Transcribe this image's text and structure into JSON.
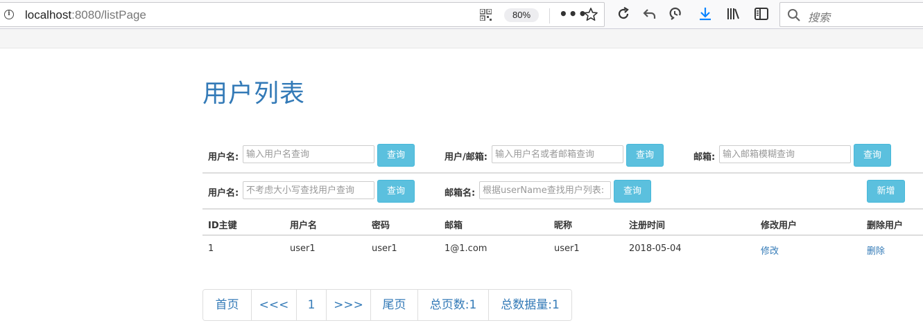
{
  "browser": {
    "url_host": "localhost",
    "url_rest": ":8080/listPage",
    "zoom": "80%",
    "search_placeholder": "搜索"
  },
  "page": {
    "title": "用户列表"
  },
  "filters": {
    "row1": [
      {
        "label": "用户名:",
        "placeholder": "输入用户名查询",
        "button": "查询"
      },
      {
        "label": "用户/邮箱:",
        "placeholder": "输入用户名或者邮箱查询",
        "button": "查询"
      },
      {
        "label": "邮箱:",
        "placeholder": "输入邮箱模糊查询",
        "button": "查询"
      }
    ],
    "row2": [
      {
        "label": "用户名:",
        "placeholder": "不考虑大小写查找用户查询",
        "button": "查询"
      },
      {
        "label": "邮箱名:",
        "placeholder": "根据userName查找用户列表:",
        "button": "查询"
      }
    ],
    "add_button": "新增"
  },
  "table": {
    "columns": [
      "ID主键",
      "用户名",
      "密码",
      "邮箱",
      "昵称",
      "注册时间",
      "修改用户",
      "删除用户"
    ],
    "rows": [
      {
        "id": "1",
        "username": "user1",
        "password": "user1",
        "email": "1@1.com",
        "nickname": "user1",
        "registered": "2018-05-04",
        "edit": "修改",
        "delete": "删除"
      }
    ]
  },
  "pagination": {
    "first": "首页",
    "prev": "<<<",
    "current": "1",
    "next": ">>>",
    "last": "尾页",
    "total_pages": "总页数:1",
    "total_records": "总数据量:1"
  },
  "colors": {
    "accent": "#337ab7",
    "button": "#5bc0de"
  }
}
